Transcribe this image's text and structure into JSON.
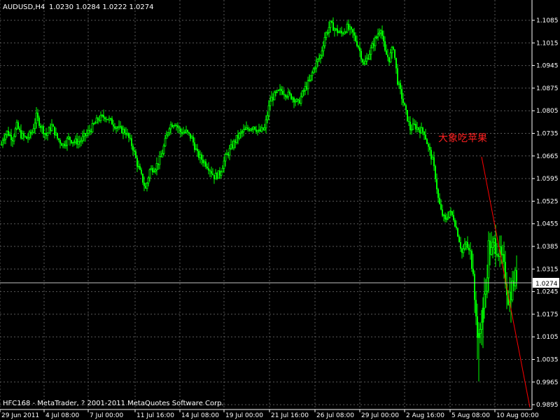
{
  "chart_data": {
    "type": "candlestick",
    "symbol_header": "AUDUSD,H4",
    "ohlc_header": "1.0230 1.0284 1.0222 1.0274",
    "current_price": 1.0274,
    "current_price_label": "1.0274",
    "annotation": "大象吃苹果",
    "copyright": "HFC168 - MetaTrader, ? 2001-2011 MetaQuotes Software Corp.",
    "ylim": [
      0.9895,
      1.1105
    ],
    "y_ticks": [
      "1.1085",
      "1.1015",
      "1.0945",
      "1.0875",
      "1.0805",
      "1.0735",
      "1.0665",
      "1.0595",
      "1.0525",
      "1.0455",
      "1.0385",
      "1.0315",
      "1.0245",
      "1.0175",
      "1.0105",
      "1.0035",
      "0.9965",
      "0.9895"
    ],
    "x_ticks": [
      "29 Jun 2011",
      "4 Jul 08:00",
      "7 Jul 00:00",
      "11 Jul 16:00",
      "14 Jul 08:00",
      "19 Jul 00:00",
      "21 Jul 16:00",
      "26 Jul 08:00",
      "29 Jul 00:00",
      "2 Aug 16:00",
      "5 Aug 08:00",
      "10 Aug 00:00"
    ],
    "price_path": [
      [
        0,
        1.066
      ],
      [
        4,
        1.07
      ],
      [
        10,
        1.072
      ],
      [
        18,
        1.07
      ],
      [
        24,
        1.074
      ],
      [
        30,
        1.071
      ],
      [
        38,
        1.07
      ],
      [
        46,
        1.072
      ],
      [
        52,
        1.077
      ],
      [
        58,
        1.074
      ],
      [
        66,
        1.071
      ],
      [
        74,
        1.074
      ],
      [
        82,
        1.07
      ],
      [
        90,
        1.068
      ],
      [
        98,
        1.07
      ],
      [
        106,
        1.069
      ],
      [
        114,
        1.069
      ],
      [
        122,
        1.071
      ],
      [
        130,
        1.073
      ],
      [
        140,
        1.076
      ],
      [
        150,
        1.077
      ],
      [
        160,
        1.075
      ],
      [
        170,
        1.073
      ],
      [
        180,
        1.072
      ],
      [
        190,
        1.067
      ],
      [
        196,
        1.062
      ],
      [
        202,
        1.058
      ],
      [
        208,
        1.054
      ],
      [
        214,
        1.06
      ],
      [
        222,
        1.061
      ],
      [
        230,
        1.064
      ],
      [
        236,
        1.069
      ],
      [
        242,
        1.074
      ],
      [
        250,
        1.075
      ],
      [
        258,
        1.072
      ],
      [
        266,
        1.072
      ],
      [
        274,
        1.07
      ],
      [
        282,
        1.065
      ],
      [
        290,
        1.063
      ],
      [
        298,
        1.061
      ],
      [
        306,
        1.058
      ],
      [
        314,
        1.059
      ],
      [
        322,
        1.064
      ],
      [
        330,
        1.067
      ],
      [
        338,
        1.07
      ],
      [
        346,
        1.072
      ],
      [
        354,
        1.073
      ],
      [
        362,
        1.074
      ],
      [
        370,
        1.072
      ],
      [
        378,
        1.073
      ],
      [
        386,
        1.082
      ],
      [
        394,
        1.084
      ],
      [
        402,
        1.085
      ],
      [
        410,
        1.084
      ],
      [
        418,
        1.083
      ],
      [
        426,
        1.081
      ],
      [
        434,
        1.085
      ],
      [
        442,
        1.088
      ],
      [
        450,
        1.093
      ],
      [
        458,
        1.096
      ],
      [
        464,
        1.102
      ],
      [
        472,
        1.106
      ],
      [
        480,
        1.104
      ],
      [
        488,
        1.103
      ],
      [
        496,
        1.105
      ],
      [
        504,
        1.103
      ],
      [
        512,
        1.099
      ],
      [
        520,
        1.093
      ],
      [
        528,
        1.097
      ],
      [
        536,
        1.101
      ],
      [
        544,
        1.105
      ],
      [
        550,
        1.097
      ],
      [
        556,
        1.095
      ],
      [
        562,
        1.099
      ],
      [
        568,
        1.088
      ],
      [
        574,
        1.083
      ],
      [
        580,
        1.078
      ],
      [
        586,
        1.073
      ],
      [
        592,
        1.074
      ],
      [
        598,
        1.073
      ],
      [
        606,
        1.072
      ],
      [
        612,
        1.067
      ],
      [
        618,
        1.063
      ],
      [
        622,
        1.058
      ],
      [
        626,
        1.051
      ],
      [
        630,
        1.047
      ],
      [
        636,
        1.044
      ],
      [
        642,
        1.047
      ],
      [
        648,
        1.045
      ],
      [
        654,
        1.04
      ],
      [
        660,
        1.034
      ],
      [
        666,
        1.037
      ],
      [
        672,
        1.033
      ],
      [
        676,
        1.03
      ],
      [
        680,
        1.013
      ],
      [
        684,
        1.006
      ],
      [
        688,
        1.014
      ],
      [
        694,
        1.022
      ],
      [
        698,
        1.036
      ],
      [
        702,
        1.034
      ],
      [
        706,
        1.037
      ],
      [
        710,
        1.036
      ],
      [
        714,
        1.033
      ],
      [
        718,
        1.031
      ],
      [
        722,
        1.026
      ],
      [
        726,
        1.02
      ],
      [
        730,
        1.022
      ],
      [
        734,
        1.025
      ],
      [
        738,
        1.027
      ]
    ]
  }
}
